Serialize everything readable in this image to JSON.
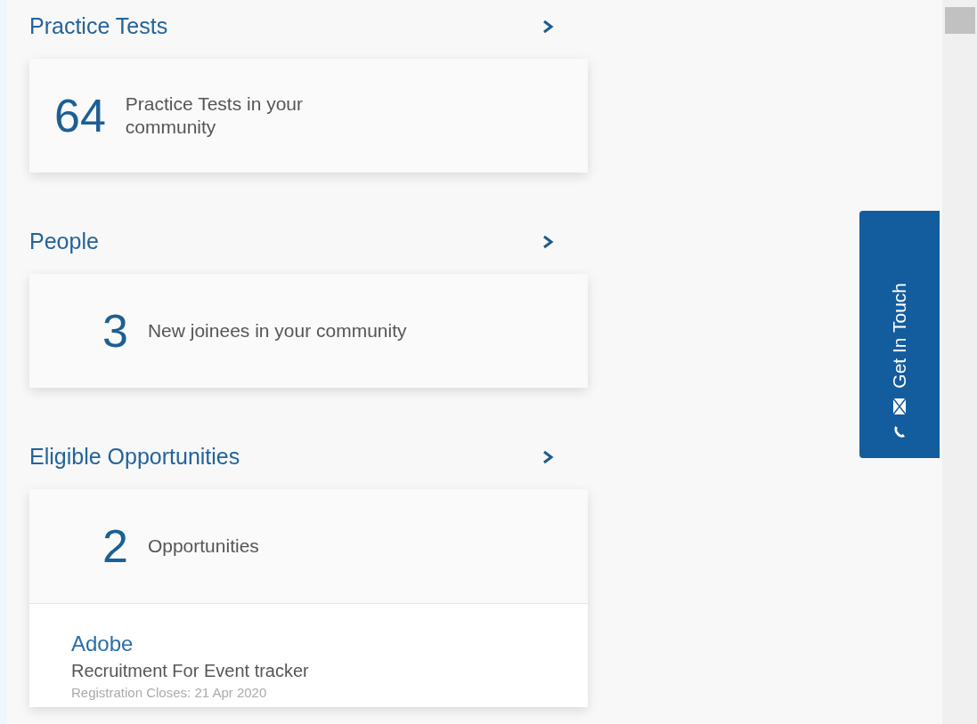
{
  "sections": [
    {
      "title": "Practice Tests",
      "count": "64",
      "caption": "Practice Tests in your community"
    },
    {
      "title": "People",
      "count": "3",
      "caption": "New joinees in your community"
    },
    {
      "title": "Eligible Opportunities",
      "count": "2",
      "caption": "Opportunities",
      "items": [
        {
          "company": "Adobe",
          "role": "Recruitment For Event tracker",
          "deadline": "Registration Closes: 21 Apr 2020"
        }
      ]
    }
  ],
  "contact_tab": {
    "label": "Get In Touch"
  }
}
